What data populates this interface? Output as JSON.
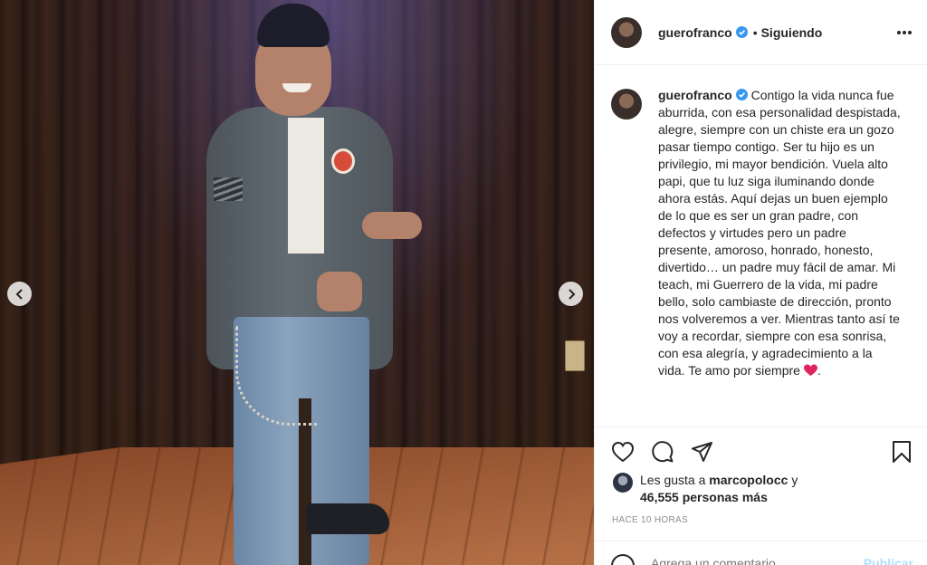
{
  "post": {
    "username": "guerofranco",
    "follow_status": "Siguiendo",
    "separator": "•",
    "caption": "Contigo la vida nunca fue aburrida, con esa personalidad despistada, alegre, siempre con un chiste era un gozo pasar tiempo contigo. Ser tu hijo es un privilegio, mi mayor bendición. Vuela alto papi, que tu luz siga iluminando donde ahora estás. Aquí dejas un buen ejemplo de lo que es ser un gran padre, con defectos y virtudes pero un padre presente, amoroso, honrado, honesto, divertido… un padre muy fácil de amar. Mi teach, mi Guerrero de la vida, mi padre bello, solo cambiaste de dirección, pronto nos volveremos a ver. Mientras tanto así te voy a recordar, siempre con esa sonrisa, con esa alegría, y agradecimiento a la vida. Te amo por siempre",
    "caption_end": ".",
    "caption_emoji": "red-heart",
    "likes_prefix": "Les gusta a",
    "likes_user": "marcopolocc",
    "likes_joiner": "y",
    "likes_count": "46,555 personas más",
    "timestamp": "HACE 10 HORAS"
  },
  "comment_box": {
    "placeholder": "Agrega un comentario...",
    "publish_label": "Publicar"
  },
  "icons": {
    "verified": "verified-badge-icon",
    "more": "more-options-icon",
    "like": "heart-icon",
    "comment": "comment-icon",
    "share": "share-icon",
    "save": "bookmark-icon",
    "prev": "chevron-left-icon",
    "next": "chevron-right-icon",
    "emoji": "emoji-icon"
  },
  "colors": {
    "verified": "#3897f0",
    "text": "#262626",
    "muted": "#8e8e8e",
    "border": "#efefef",
    "heart": "#e0245e",
    "publish": "#b2dffc"
  }
}
